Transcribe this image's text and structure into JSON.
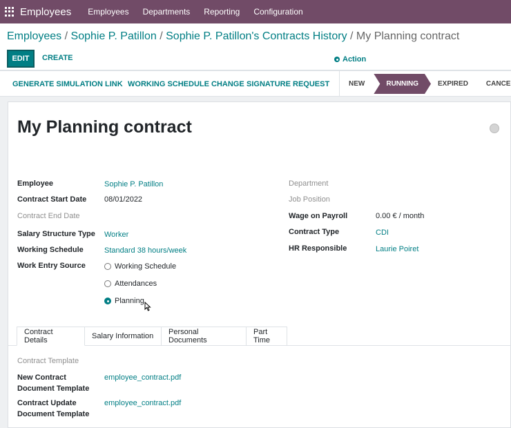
{
  "topbar": {
    "app_name": "Employees",
    "menu": [
      "Employees",
      "Departments",
      "Reporting",
      "Configuration"
    ]
  },
  "breadcrumb": {
    "items": [
      "Employees",
      "Sophie P. Patillon",
      "Sophie P. Patillon's Contracts History"
    ],
    "current": "My Planning contract",
    "sep": "/"
  },
  "buttons": {
    "edit": "EDIT",
    "create": "CREATE",
    "action": "Action"
  },
  "statusbar": {
    "actions": [
      "GENERATE SIMULATION LINK",
      "WORKING SCHEDULE CHANGE",
      "SIGNATURE REQUEST"
    ],
    "stages": [
      "NEW",
      "RUNNING",
      "EXPIRED",
      "CANCELLED"
    ],
    "active_stage": "RUNNING"
  },
  "form": {
    "title": "My Planning contract",
    "left": {
      "employee": {
        "label": "Employee",
        "value": "Sophie P. Patillon"
      },
      "start_date": {
        "label": "Contract Start Date",
        "value": "08/01/2022"
      },
      "end_date": {
        "label": "Contract End Date"
      },
      "salary_structure": {
        "label": "Salary Structure Type",
        "value": "Worker"
      },
      "working_schedule": {
        "label": "Working Schedule",
        "value": "Standard 38 hours/week"
      },
      "work_entry_source": {
        "label": "Work Entry Source",
        "options": [
          "Working Schedule",
          "Attendances",
          "Planning"
        ],
        "selected": "Planning"
      }
    },
    "right": {
      "department": {
        "label": "Department"
      },
      "job_position": {
        "label": "Job Position"
      },
      "wage": {
        "label": "Wage on Payroll",
        "value": "0.00 €",
        "unit": "/ month"
      },
      "contract_type": {
        "label": "Contract Type",
        "value": "CDI"
      },
      "hr_responsible": {
        "label": "HR Responsible",
        "value": "Laurie Poiret"
      }
    },
    "tabs": [
      "Contract Details",
      "Salary Information",
      "Personal Documents",
      "Part Time"
    ],
    "active_tab": "Contract Details",
    "details": {
      "contract_template": {
        "label": "Contract Template"
      },
      "new_doc": {
        "label_line1": "New Contract",
        "label_line2": "Document Template",
        "value": "employee_contract.pdf"
      },
      "update_doc": {
        "label_line1": "Contract Update",
        "label_line2": "Document Template",
        "value": "employee_contract.pdf"
      }
    }
  },
  "colors": {
    "brand": "#714b67",
    "accent": "#017e84"
  }
}
